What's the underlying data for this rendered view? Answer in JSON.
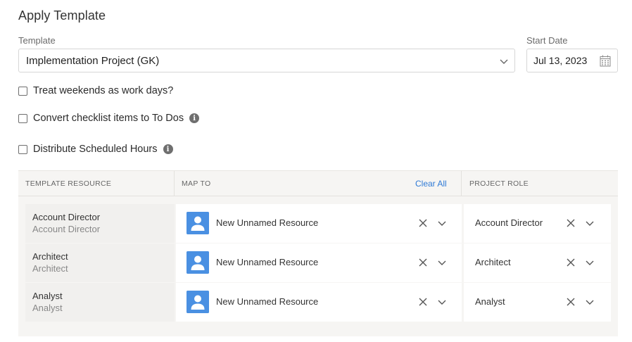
{
  "header": {
    "title": "Apply Template"
  },
  "form": {
    "template_label": "Template",
    "template_value": "Implementation Project (GK)",
    "start_label": "Start Date",
    "start_value": "Jul 13, 2023"
  },
  "options": [
    {
      "label": "Treat weekends as work days?",
      "checked": false,
      "info": false
    },
    {
      "label": "Convert checklist items to To Dos",
      "checked": false,
      "info": true
    },
    {
      "label": "Distribute Scheduled Hours",
      "checked": false,
      "info": true
    }
  ],
  "table": {
    "headers": {
      "resource": "TEMPLATE RESOURCE",
      "map_to": "MAP TO",
      "clear_all": "Clear All",
      "role": "PROJECT ROLE"
    },
    "rows": [
      {
        "resource": "Account Director",
        "resource_sub": "Account Director",
        "map_to": "New Unnamed Resource",
        "role": "Account Director"
      },
      {
        "resource": "Architect",
        "resource_sub": "Architect",
        "map_to": "New Unnamed Resource",
        "role": "Architect"
      },
      {
        "resource": "Analyst",
        "resource_sub": "Analyst",
        "map_to": "New Unnamed Resource",
        "role": "Analyst"
      }
    ]
  },
  "colors": {
    "accent": "#2f7ad6",
    "avatar": "#4a90e2"
  },
  "icons": {
    "dropdown": "chevron-down-icon",
    "date": "calendar-icon",
    "clear": "close-icon",
    "info": "info-icon",
    "avatar": "user-avatar-icon"
  }
}
